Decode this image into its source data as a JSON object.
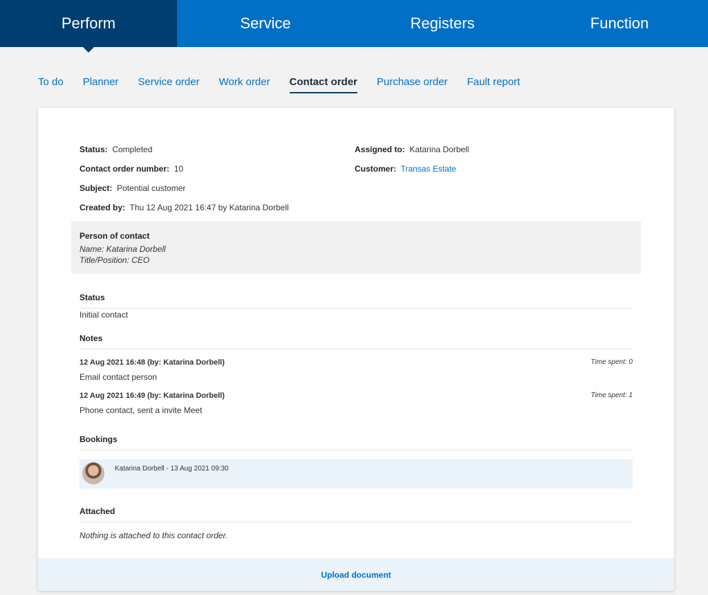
{
  "top_nav": {
    "tabs": [
      "Perform",
      "Service",
      "Registers",
      "Function"
    ]
  },
  "sub_nav": {
    "tabs": [
      "To do",
      "Planner",
      "Service order",
      "Work order",
      "Contact order",
      "Purchase order",
      "Fault report"
    ]
  },
  "details": {
    "status_label": "Status:",
    "status_value": "Completed",
    "number_label": "Contact order number:",
    "number_value": "10",
    "subject_label": "Subject:",
    "subject_value": "Potential customer",
    "created_label": "Created by:",
    "created_value": "Thu 12 Aug 2021 16:47 by Katarina Dorbell",
    "assigned_label": "Assigned to:",
    "assigned_value": "Katarina Dorbell",
    "customer_label": "Customer:",
    "customer_value": "Transas Estate"
  },
  "contact": {
    "title": "Person of contact",
    "name": "Name: Katarina Dorbell",
    "position": "Title/Position: CEO"
  },
  "status_section": {
    "heading": "Status",
    "value": "Initial contact"
  },
  "notes_section": {
    "heading": "Notes",
    "items": [
      {
        "meta": "12 Aug 2021 16:48 (by: Katarina Dorbell)",
        "time": "Time spent: 0",
        "text": "Email contact person"
      },
      {
        "meta": "12 Aug 2021 16:49 (by: Katarina Dorbell)",
        "time": "Time spent: 1",
        "text": "Phone contact, sent a invite Meet"
      }
    ]
  },
  "bookings_section": {
    "heading": "Bookings",
    "items": [
      {
        "text": "Katarina Dorbell - 13 Aug 2021 09:30"
      }
    ]
  },
  "attached_section": {
    "heading": "Attached",
    "empty_text": "Nothing is attached to this contact order."
  },
  "upload_label": "Upload document",
  "colors": {
    "brand_blue": "#0070c7",
    "active_tab": "#003e70",
    "booking_bg": "#eaf2fa"
  }
}
